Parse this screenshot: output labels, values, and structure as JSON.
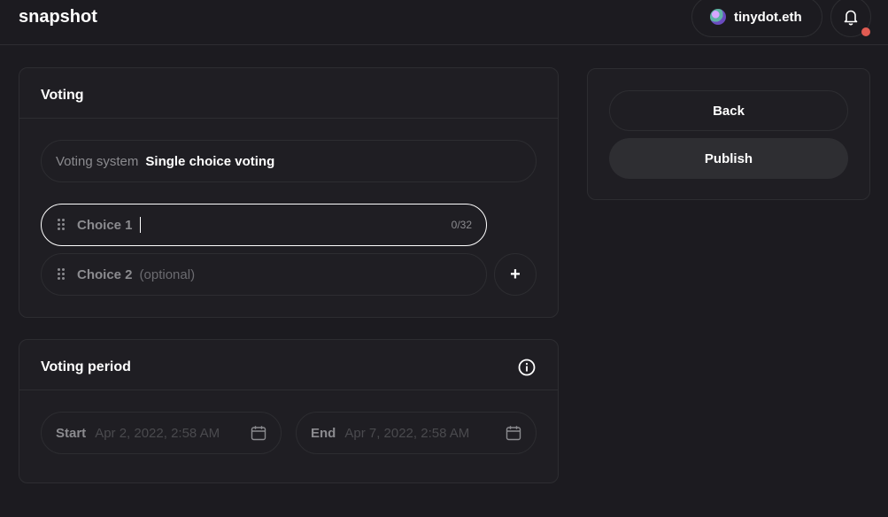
{
  "app": {
    "logo": "snapshot"
  },
  "account": {
    "name": "tinydot.eth"
  },
  "notifications": {
    "indicator_color": "#e15b52"
  },
  "voting": {
    "title": "Voting",
    "system_label": "Voting system",
    "system_value": "Single choice voting",
    "choices": [
      {
        "label": "Choice 1",
        "value": "",
        "counter": "0/32"
      },
      {
        "label": "Choice 2",
        "hint": "(optional)"
      }
    ],
    "add_choice": "+"
  },
  "period": {
    "title": "Voting period",
    "start_label": "Start",
    "start_placeholder": "Apr 2, 2022, 2:58 AM",
    "end_label": "End",
    "end_placeholder": "Apr 7, 2022, 2:58 AM"
  },
  "actions": {
    "back": "Back",
    "publish": "Publish"
  }
}
